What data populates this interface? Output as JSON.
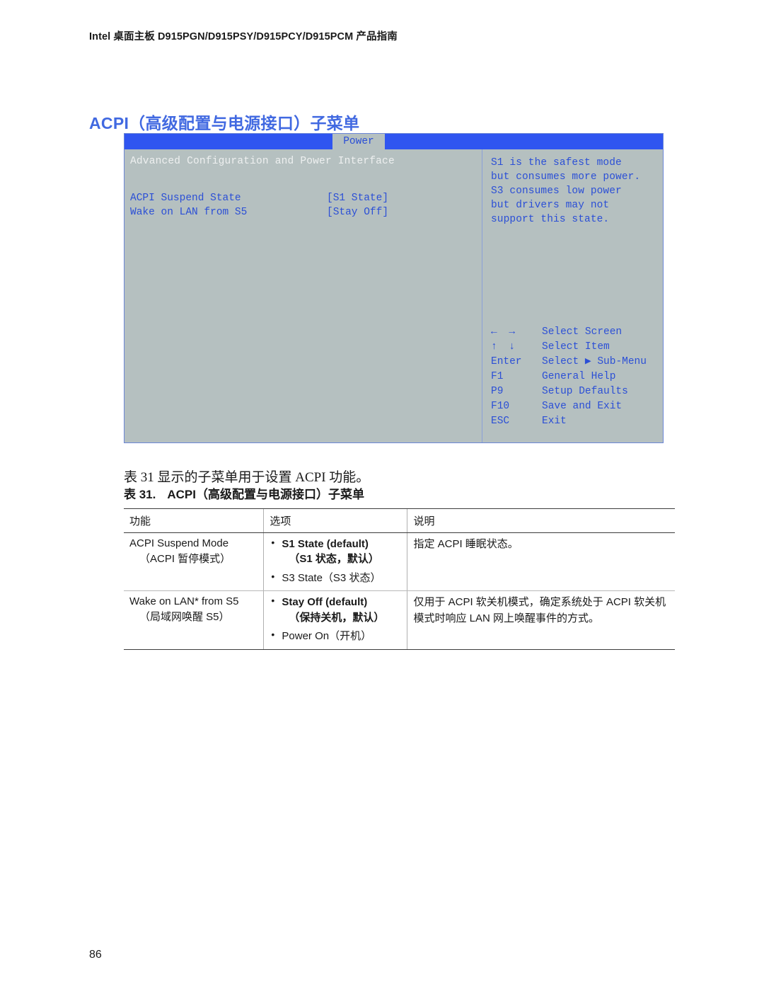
{
  "header": {
    "running_head": "Intel 桌面主板 D915PGN/D915PSY/D915PCY/D915PCM 产品指南"
  },
  "section": {
    "title": "ACPI（高级配置与电源接口）子菜单"
  },
  "bios_screen": {
    "active_tab": "Power",
    "heading": "Advanced Configuration and Power Interface",
    "settings": [
      {
        "label": "ACPI Suspend State",
        "value": "[S1 State]"
      },
      {
        "label": "Wake on LAN from S5",
        "value": "[Stay Off]"
      }
    ],
    "help_lines": [
      "S1 is the safest mode",
      "but consumes more power.",
      "S3 consumes low power",
      "but drivers may not",
      "support this state."
    ],
    "key_legend": [
      {
        "key": "←  →",
        "desc": "Select Screen"
      },
      {
        "key": "↑  ↓",
        "desc": "Select Item"
      },
      {
        "key": "Enter",
        "desc": "Select ▶ Sub-Menu"
      },
      {
        "key": "F1",
        "desc": "General Help"
      },
      {
        "key": "P9",
        "desc": "Setup Defaults"
      },
      {
        "key": "F10",
        "desc": "Save and Exit"
      },
      {
        "key": "ESC",
        "desc": "Exit"
      }
    ],
    "colors": {
      "background": "#b5c0c0",
      "tab_bar": "#2f55f0",
      "text": "#2b4fd6",
      "heading_text": "#eef0f0",
      "border": "#6b86d6"
    }
  },
  "caption": {
    "intro": "表 31 显示的子菜单用于设置 ACPI 功能。",
    "table_number": "表 31.",
    "table_title": "ACPI（高级配置与电源接口）子菜单"
  },
  "table": {
    "headers": [
      "功能",
      "选项",
      "说明"
    ],
    "rows": [
      {
        "feature_en": "ACPI Suspend Mode",
        "feature_cn": "（ACPI 暂停模式）",
        "options": [
          {
            "en": "S1 State (default)",
            "cn": "（S1 状态，默认）",
            "bold": true
          },
          {
            "en": "S3 State（S3 状态）",
            "cn": "",
            "bold": false
          }
        ],
        "description": "指定 ACPI 睡眠状态。"
      },
      {
        "feature_en": "Wake on LAN* from S5",
        "feature_cn": "（局域网唤醒 S5）",
        "options": [
          {
            "en": "Stay Off (default)",
            "cn": "（保持关机，默认）",
            "bold": true
          },
          {
            "en": "Power On（开机）",
            "cn": "",
            "bold": false
          }
        ],
        "description": "仅用于 ACPI 软关机模式，确定系统处于 ACPI 软关机模式时响应 LAN 网上唤醒事件的方式。"
      }
    ]
  },
  "footer": {
    "page_number": "86"
  }
}
